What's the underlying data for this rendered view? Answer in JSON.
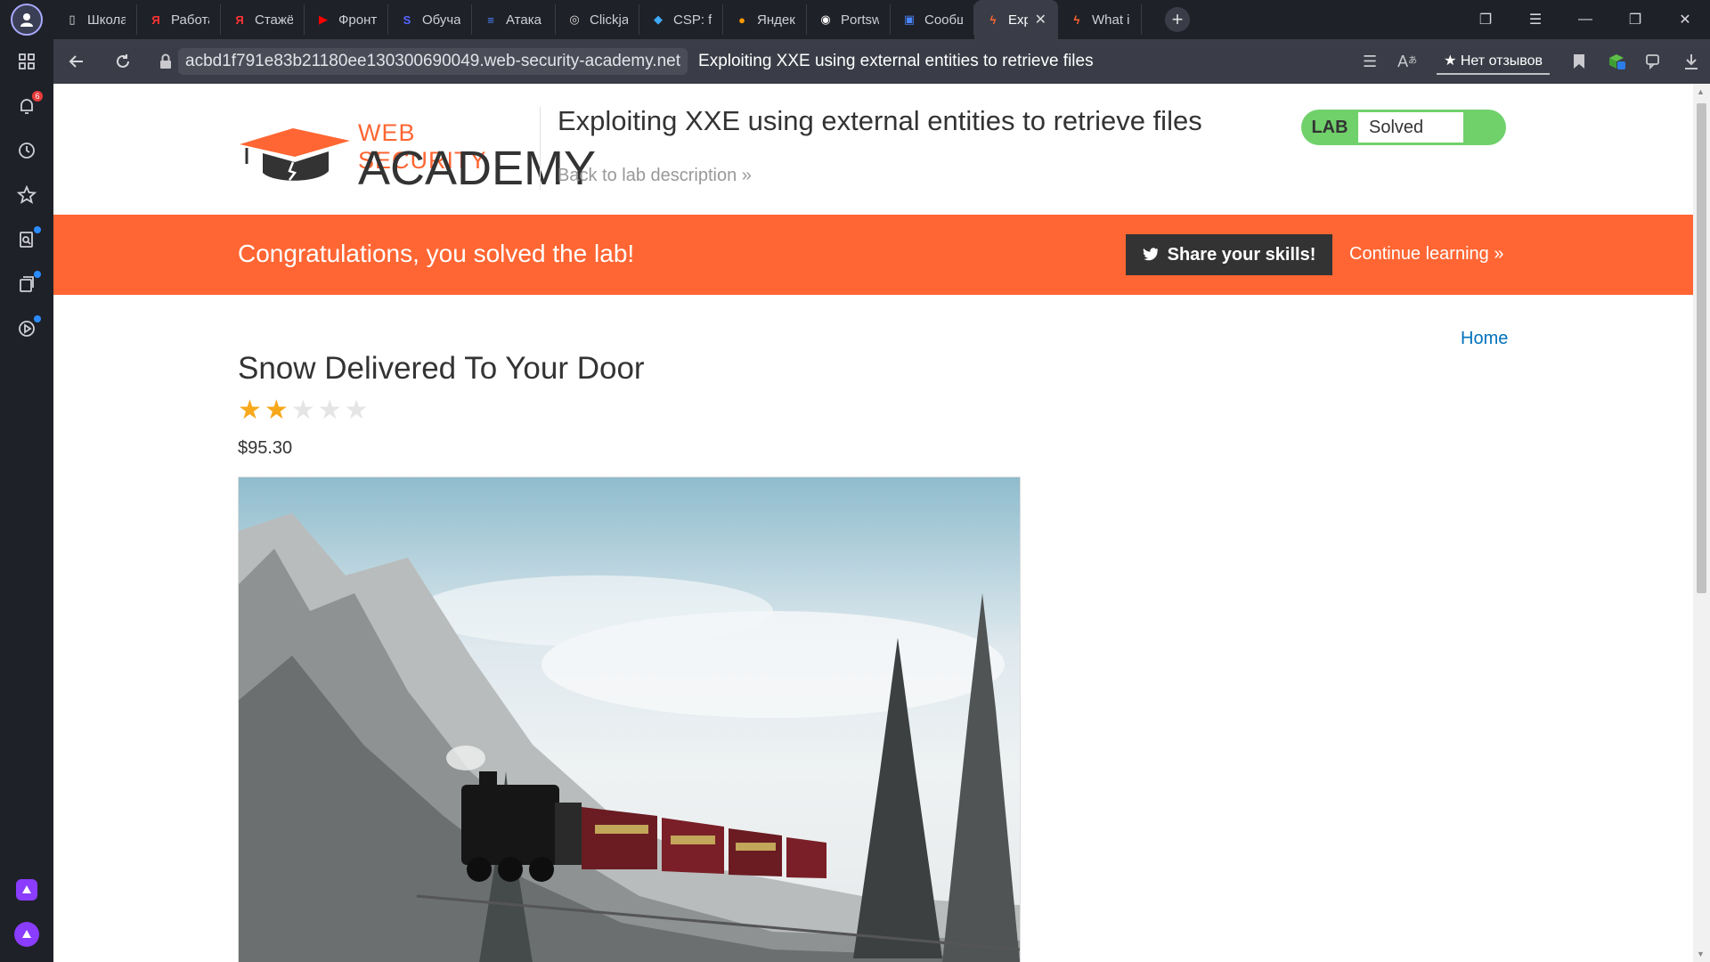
{
  "browser": {
    "tabs": [
      {
        "label": "Школа",
        "icon": "page-icon"
      },
      {
        "label": "Работа",
        "icon": "yandex-icon"
      },
      {
        "label": "Стажёр",
        "icon": "yandex-icon"
      },
      {
        "label": "Фронте",
        "icon": "youtube-icon"
      },
      {
        "label": "Обучак",
        "icon": "s-icon"
      },
      {
        "label": "Атака т",
        "icon": "docs-icon"
      },
      {
        "label": "Clickjacl",
        "icon": "clickjack-icon"
      },
      {
        "label": "CSP: fra",
        "icon": "csp-icon"
      },
      {
        "label": "Яндекс",
        "icon": "yandex-browser-icon"
      },
      {
        "label": "Portswi",
        "icon": "github-icon"
      },
      {
        "label": "Сообщ",
        "icon": "message-icon"
      },
      {
        "label": "Explo",
        "icon": "portswigger-icon",
        "active": true
      },
      {
        "label": "What is",
        "icon": "portswigger-icon"
      }
    ],
    "url": "acbd1f791e83b21180ee130300690049.web-security-academy.net",
    "page_title": "Exploiting XXE using external entities to retrieve files",
    "reviews_label": "★ Нет отзывов",
    "notification_badge": "6"
  },
  "page": {
    "logo": {
      "top": "WEB SECURITY",
      "bottom": "ACADEMY"
    },
    "lab_title": "Exploiting XXE using external entities to retrieve files",
    "back_link": "Back to lab description",
    "status": {
      "label": "LAB",
      "value": "Solved"
    },
    "banner": {
      "message": "Congratulations, you solved the lab!",
      "share": "Share your skills!",
      "continue": "Continue learning"
    },
    "home": "Home",
    "product": {
      "name": "Snow Delivered To Your Door",
      "rating": 2,
      "rating_max": 5,
      "price": "$95.30"
    }
  },
  "colors": {
    "accent": "#ff6633",
    "solved_green": "#70d16b",
    "link_blue": "#0071bc",
    "star_gold": "#f7a81b"
  }
}
